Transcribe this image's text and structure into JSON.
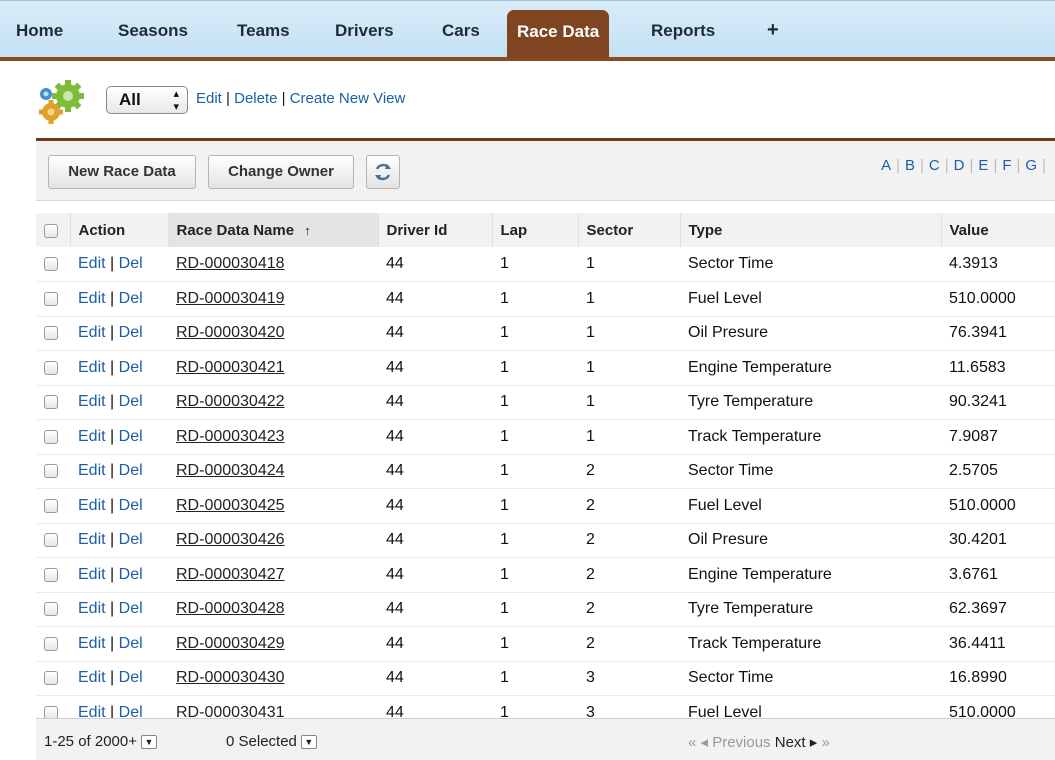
{
  "tabs": [
    {
      "label": "Home",
      "active": false
    },
    {
      "label": "Seasons",
      "active": false
    },
    {
      "label": "Teams",
      "active": false
    },
    {
      "label": "Drivers",
      "active": false
    },
    {
      "label": "Cars",
      "active": false
    },
    {
      "label": "Race Data",
      "active": true
    },
    {
      "label": "Reports",
      "active": false
    }
  ],
  "add_tab_label": "+",
  "view": {
    "selected": "All",
    "edit_label": "Edit",
    "delete_label": "Delete",
    "create_label": "Create New View",
    "separator": "|"
  },
  "toolbar": {
    "new_label": "New Race Data",
    "change_owner_label": "Change Owner",
    "refresh_icon": "refresh-icon",
    "alpha_letters": [
      "A",
      "B",
      "C",
      "D",
      "E",
      "F",
      "G"
    ]
  },
  "table": {
    "columns": [
      "Action",
      "Race Data Name",
      "Driver Id",
      "Lap",
      "Sector",
      "Type",
      "Value"
    ],
    "sort_indicator": "↑",
    "row_actions": {
      "edit": "Edit",
      "del": "Del",
      "sep": "|"
    },
    "rows": [
      {
        "name": "RD-000030418",
        "driver": "44",
        "lap": "1",
        "sector": "1",
        "type": "Sector Time",
        "value": "4.3913"
      },
      {
        "name": "RD-000030419",
        "driver": "44",
        "lap": "1",
        "sector": "1",
        "type": "Fuel Level",
        "value": "510.0000"
      },
      {
        "name": "RD-000030420",
        "driver": "44",
        "lap": "1",
        "sector": "1",
        "type": "Oil Presure",
        "value": "76.3941"
      },
      {
        "name": "RD-000030421",
        "driver": "44",
        "lap": "1",
        "sector": "1",
        "type": "Engine Temperature",
        "value": "11.6583"
      },
      {
        "name": "RD-000030422",
        "driver": "44",
        "lap": "1",
        "sector": "1",
        "type": "Tyre Temperature",
        "value": "90.3241"
      },
      {
        "name": "RD-000030423",
        "driver": "44",
        "lap": "1",
        "sector": "1",
        "type": "Track Temperature",
        "value": "7.9087"
      },
      {
        "name": "RD-000030424",
        "driver": "44",
        "lap": "1",
        "sector": "2",
        "type": "Sector Time",
        "value": "2.5705"
      },
      {
        "name": "RD-000030425",
        "driver": "44",
        "lap": "1",
        "sector": "2",
        "type": "Fuel Level",
        "value": "510.0000"
      },
      {
        "name": "RD-000030426",
        "driver": "44",
        "lap": "1",
        "sector": "2",
        "type": "Oil Presure",
        "value": "30.4201"
      },
      {
        "name": "RD-000030427",
        "driver": "44",
        "lap": "1",
        "sector": "2",
        "type": "Engine Temperature",
        "value": "3.6761"
      },
      {
        "name": "RD-000030428",
        "driver": "44",
        "lap": "1",
        "sector": "2",
        "type": "Tyre Temperature",
        "value": "62.3697"
      },
      {
        "name": "RD-000030429",
        "driver": "44",
        "lap": "1",
        "sector": "2",
        "type": "Track Temperature",
        "value": "36.4411"
      },
      {
        "name": "RD-000030430",
        "driver": "44",
        "lap": "1",
        "sector": "3",
        "type": "Sector Time",
        "value": "16.8990"
      },
      {
        "name": "RD-000030431",
        "driver": "44",
        "lap": "1",
        "sector": "3",
        "type": "Fuel Level",
        "value": "510.0000"
      }
    ]
  },
  "footer": {
    "count_label": "1-25 of 2000+",
    "selected_label": "0 Selected",
    "first_label": "«",
    "previous_label": "◂ Previous",
    "next_label": "Next ▸",
    "last_label": "»"
  },
  "colors": {
    "accent_brown": "#7f4521",
    "tab_bar_blue": "#c4e1f3",
    "link_blue": "#1b5fa6"
  }
}
